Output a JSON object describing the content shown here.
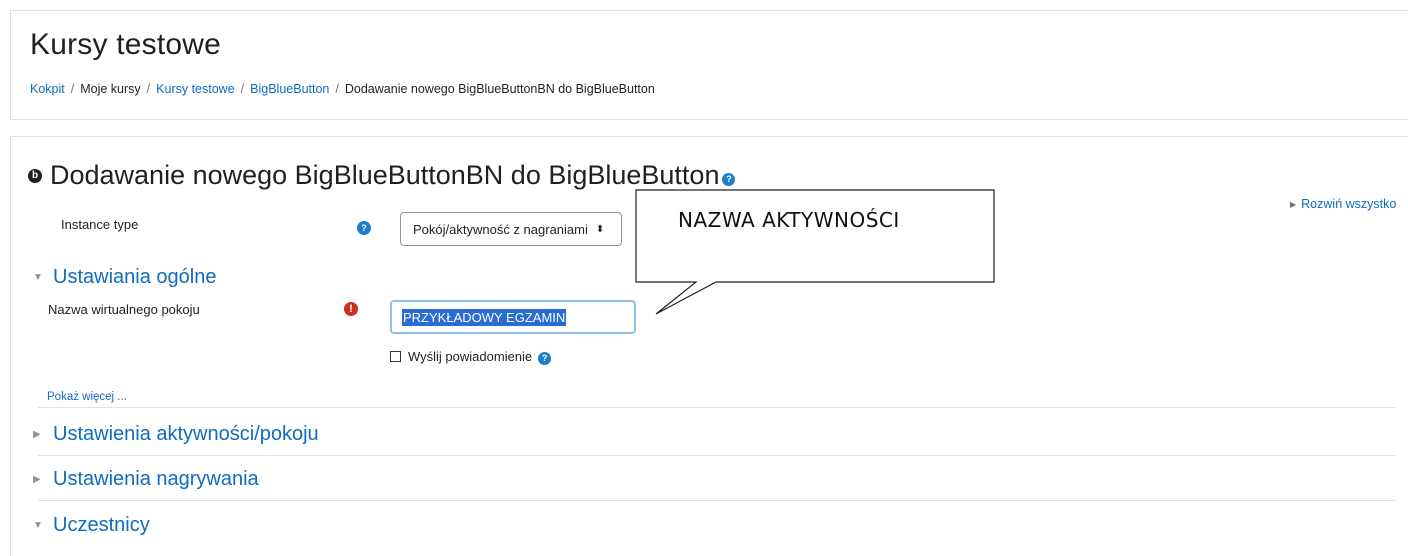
{
  "header": {
    "course_title": "Kursy testowe",
    "breadcrumb": [
      {
        "label": "Kokpit",
        "link": true
      },
      {
        "label": "Moje kursy",
        "link": false
      },
      {
        "label": "Kursy testowe",
        "link": true
      },
      {
        "label": "BigBlueButton",
        "link": true
      },
      {
        "label": "Dodawanie nowego BigBlueButtonBN do BigBlueButton",
        "link": false
      }
    ],
    "separator": "/"
  },
  "main": {
    "logo_glyph": "b",
    "page_heading": "Dodawanie nowego BigBlueButtonBN do BigBlueButton",
    "expand_all": "Rozwiń wszystko",
    "instance_type": {
      "label": "Instance type",
      "selected": "Pokój/aktywność z nagraniami"
    },
    "general_section": {
      "title": "Ustawiania ogólne",
      "expanded": true,
      "room_name": {
        "label": "Nazwa wirtualnego pokoju",
        "value": "PRZYKŁADOWY EGZAMIN",
        "required": true
      },
      "notify": {
        "label": "Wyślij powiadomienie",
        "checked": false
      },
      "show_more": "Pokaż więcej ..."
    },
    "collapsed_sections": [
      {
        "title": "Ustawienia aktywności/pokoju"
      },
      {
        "title": "Ustawienia nagrywania"
      }
    ],
    "participants_section": {
      "title": "Uczestnicy",
      "expanded": true
    }
  },
  "annotation": {
    "callout_text": "NAZWA AKTYWNOŚCI"
  },
  "colors": {
    "link": "#0f6cbf",
    "help_icon": "#1f7ec8",
    "required_icon": "#ca3120",
    "selection": "#2a6cd5",
    "input_focus_border": "#8fc0ea"
  },
  "icons": {
    "help": "question-circle-icon",
    "required": "exclamation-circle-icon",
    "section_expanded": "caret-down-icon",
    "section_collapsed": "caret-right-icon",
    "select_caret": "sort-icon"
  }
}
